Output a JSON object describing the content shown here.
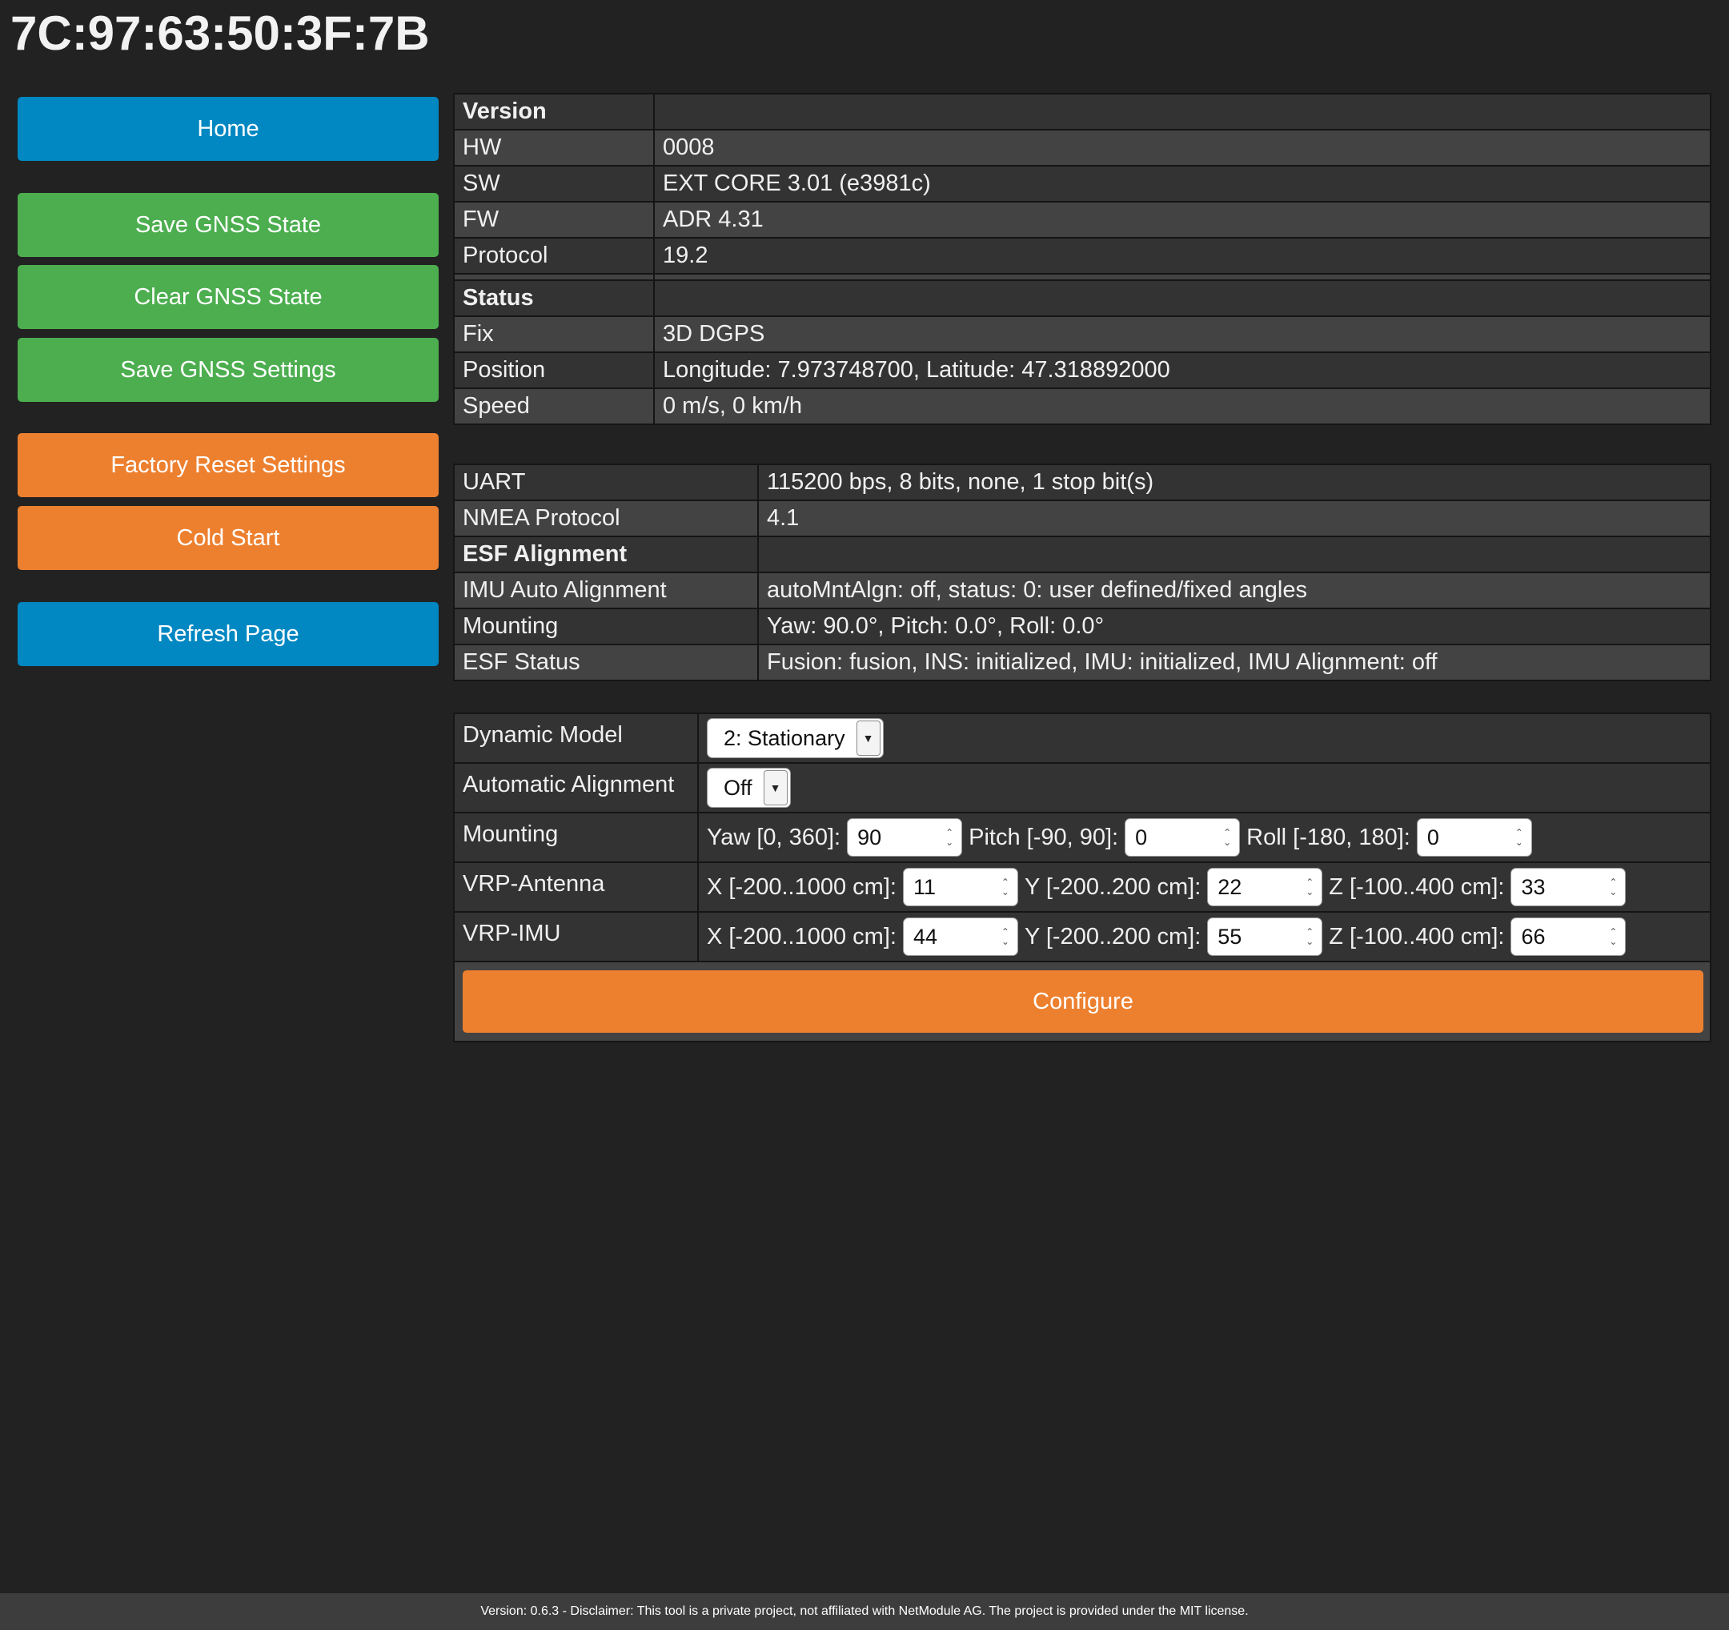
{
  "page": {
    "title": "7C:97:63:50:3F:7B"
  },
  "sidebar": {
    "buttons": [
      {
        "label": "Home",
        "color": "#0188c2"
      },
      {
        "label": "Save GNSS State",
        "color": "#4cae4f"
      },
      {
        "label": "Clear GNSS State",
        "color": "#4cae4f"
      },
      {
        "label": "Save GNSS Settings",
        "color": "#4cae4f"
      },
      {
        "label": "Factory Reset Settings",
        "color": "#ed802f"
      },
      {
        "label": "Cold Start",
        "color": "#ed802f"
      },
      {
        "label": "Refresh Page",
        "color": "#0188c2"
      }
    ]
  },
  "info": {
    "version_header": "Version",
    "hw": {
      "label": "HW",
      "value": "0008"
    },
    "sw": {
      "label": "SW",
      "value": "EXT CORE 3.01 (e3981c)"
    },
    "fw": {
      "label": "FW",
      "value": "ADR 4.31"
    },
    "protocol": {
      "label": "Protocol",
      "value": "19.2"
    },
    "status_header": "Status",
    "fix": {
      "label": "Fix",
      "value": "3D DGPS"
    },
    "position": {
      "label": "Position",
      "value": "Longitude: 7.973748700, Latitude: 47.318892000"
    },
    "speed": {
      "label": "Speed",
      "value": "0 m/s, 0 km/h"
    }
  },
  "comm": {
    "uart": {
      "label": "UART",
      "value": "115200 bps, 8 bits, none, 1 stop bit(s)"
    },
    "nmea": {
      "label": "NMEA Protocol",
      "value": "4.1"
    },
    "esf_header": "ESF Alignment",
    "imu_auto": {
      "label": "IMU Auto Alignment",
      "value": "autoMntAlgn: off, status: 0: user defined/fixed angles"
    },
    "mounting": {
      "label": "Mounting",
      "value": "Yaw: 90.0°, Pitch: 0.0°, Roll: 0.0°"
    },
    "esf_status": {
      "label": "ESF Status",
      "value": "Fusion: fusion, INS: initialized, IMU: initialized, IMU Alignment: off"
    }
  },
  "config": {
    "dynamic_model": {
      "label": "Dynamic Model",
      "selected": "2: Stationary"
    },
    "auto_alignment": {
      "label": "Automatic Alignment",
      "selected": "Off"
    },
    "mounting": {
      "label": "Mounting",
      "yaw_label": "Yaw [0, 360]:",
      "yaw": "90",
      "pitch_label": "Pitch [-90, 90]:",
      "pitch": "0",
      "roll_label": "Roll [-180, 180]:",
      "roll": "0"
    },
    "vrp_antenna": {
      "label": "VRP-Antenna",
      "x_label": "X [-200..1000 cm]:",
      "x": "11",
      "y_label": "Y [-200..200 cm]:",
      "y": "22",
      "z_label": "Z [-100..400 cm]:",
      "z": "33"
    },
    "vrp_imu": {
      "label": "VRP-IMU",
      "x_label": "X [-200..1000 cm]:",
      "x": "44",
      "y_label": "Y [-200..200 cm]:",
      "y": "55",
      "z_label": "Z [-100..400 cm]:",
      "z": "66"
    },
    "configure_label": "Configure"
  },
  "footer": {
    "text": "Version: 0.6.3 - Disclaimer: This tool is a private project, not affiliated with NetModule AG. The project is provided under the MIT license."
  }
}
